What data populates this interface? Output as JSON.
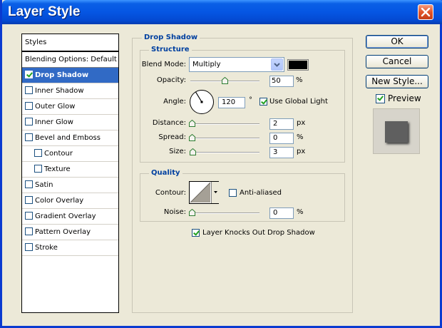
{
  "window": {
    "title": "Layer Style"
  },
  "styles_panel": {
    "header": "Styles",
    "items": [
      {
        "label": "Blending Options: Default",
        "checkbox": false,
        "checked": false,
        "selected": false,
        "indent": false
      },
      {
        "label": "Drop Shadow",
        "checkbox": true,
        "checked": true,
        "selected": true,
        "indent": false
      },
      {
        "label": "Inner Shadow",
        "checkbox": true,
        "checked": false,
        "selected": false,
        "indent": false
      },
      {
        "label": "Outer Glow",
        "checkbox": true,
        "checked": false,
        "selected": false,
        "indent": false
      },
      {
        "label": "Inner Glow",
        "checkbox": true,
        "checked": false,
        "selected": false,
        "indent": false
      },
      {
        "label": "Bevel and Emboss",
        "checkbox": true,
        "checked": false,
        "selected": false,
        "indent": false
      },
      {
        "label": "Contour",
        "checkbox": true,
        "checked": false,
        "selected": false,
        "indent": true
      },
      {
        "label": "Texture",
        "checkbox": true,
        "checked": false,
        "selected": false,
        "indent": true
      },
      {
        "label": "Satin",
        "checkbox": true,
        "checked": false,
        "selected": false,
        "indent": false
      },
      {
        "label": "Color Overlay",
        "checkbox": true,
        "checked": false,
        "selected": false,
        "indent": false
      },
      {
        "label": "Gradient Overlay",
        "checkbox": true,
        "checked": false,
        "selected": false,
        "indent": false
      },
      {
        "label": "Pattern Overlay",
        "checkbox": true,
        "checked": false,
        "selected": false,
        "indent": false
      },
      {
        "label": "Stroke",
        "checkbox": true,
        "checked": false,
        "selected": false,
        "indent": false
      }
    ]
  },
  "drop_shadow": {
    "title": "Drop Shadow",
    "structure": {
      "title": "Structure",
      "blend_mode_label": "Blend Mode:",
      "blend_mode_value": "Multiply",
      "shadow_color": "#000000",
      "opacity_label": "Opacity:",
      "opacity_value": "50",
      "opacity_unit": "%",
      "opacity_level": 0.5,
      "angle_label": "Angle:",
      "angle_value": "120",
      "angle_unit": "°",
      "use_global_light_label": "Use Global Light",
      "use_global_light_checked": true,
      "distance_label": "Distance:",
      "distance_value": "2",
      "distance_unit": "px",
      "spread_label": "Spread:",
      "spread_value": "0",
      "spread_unit": "%",
      "size_label": "Size:",
      "size_value": "3",
      "size_unit": "px"
    },
    "quality": {
      "title": "Quality",
      "contour_label": "Contour:",
      "anti_aliased_label": "Anti-aliased",
      "anti_aliased_checked": false,
      "noise_label": "Noise:",
      "noise_value": "0",
      "noise_unit": "%"
    },
    "knockout_label": "Layer Knocks Out Drop Shadow",
    "knockout_checked": true
  },
  "buttons": {
    "ok": "OK",
    "cancel": "Cancel",
    "new_style": "New Style...",
    "preview_label": "Preview",
    "preview_checked": true
  },
  "colors": {
    "title_bar": "#0556e3",
    "selection": "#316ac5",
    "group_title": "#0040a0",
    "dialog_bg": "#ece9d8"
  }
}
